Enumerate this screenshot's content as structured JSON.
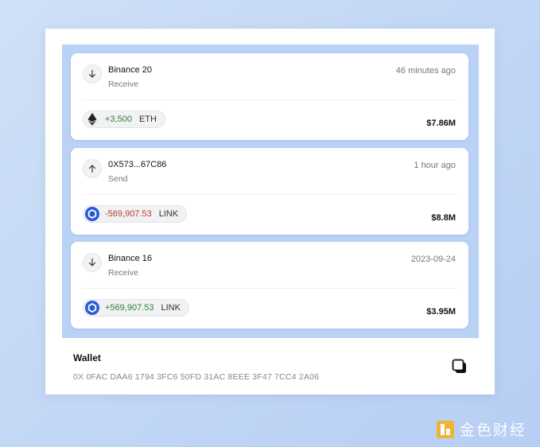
{
  "transactions": [
    {
      "direction": "receive",
      "direction_icon": "arrow-down-icon",
      "name": "Binance 20",
      "type": "Receive",
      "time": "46 minutes ago",
      "amount": "+3,500",
      "token": "ETH",
      "token_icon": "ethereum-icon",
      "value": "$7.86M"
    },
    {
      "direction": "send",
      "direction_icon": "arrow-up-icon",
      "name": "0X573...67C86",
      "type": "Send",
      "time": "1 hour ago",
      "amount": "-569,907.53",
      "token": "LINK",
      "token_icon": "chainlink-icon",
      "value": "$8.8M"
    },
    {
      "direction": "receive",
      "direction_icon": "arrow-down-icon",
      "name": "Binance 16",
      "type": "Receive",
      "time": "2023-09-24",
      "amount": "+569,907.53",
      "token": "LINK",
      "token_icon": "chainlink-icon",
      "value": "$3.95M"
    }
  ],
  "wallet": {
    "label": "Wallet",
    "address": "0X 0FAC DAA6 1794 3FC6 50FD 31AC 8EEE 3F47 7CC4 2A06",
    "copy_icon": "copy-icon"
  },
  "watermark": {
    "text": "金色财经"
  },
  "colors": {
    "positive": "#2e7d32",
    "negative": "#c0392b",
    "panel": "#b9d2f6",
    "link_brand": "#2a5ada"
  }
}
